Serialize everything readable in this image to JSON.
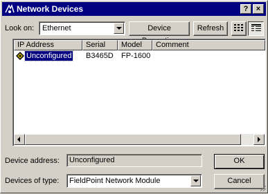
{
  "window": {
    "title": "Network Devices",
    "help_label": "?",
    "close_label": "×"
  },
  "toolbar": {
    "look_on_label": "Look on:",
    "look_on_value": "Ethernet",
    "device_properties_label": "Device Properties",
    "refresh_label": "Refresh",
    "icons": [
      "small-icons-view-icon",
      "details-view-icon"
    ]
  },
  "table": {
    "columns": [
      "IP Address",
      "Serial",
      "Model",
      "Comment"
    ],
    "rows": [
      {
        "ip": "Unconfigured",
        "serial": "B3465D",
        "model": "FP-1600",
        "comment": ""
      }
    ]
  },
  "form": {
    "device_address_label": "Device address:",
    "device_address_value": "Unconfigured",
    "devices_of_type_label": "Devices of type:",
    "devices_of_type_value": "FieldPoint Network Module"
  },
  "buttons": {
    "ok_label": "OK",
    "cancel_label": "Cancel"
  },
  "colors": {
    "titlebar": "#000080",
    "face": "#d4d0c8",
    "selection": "#000080"
  }
}
